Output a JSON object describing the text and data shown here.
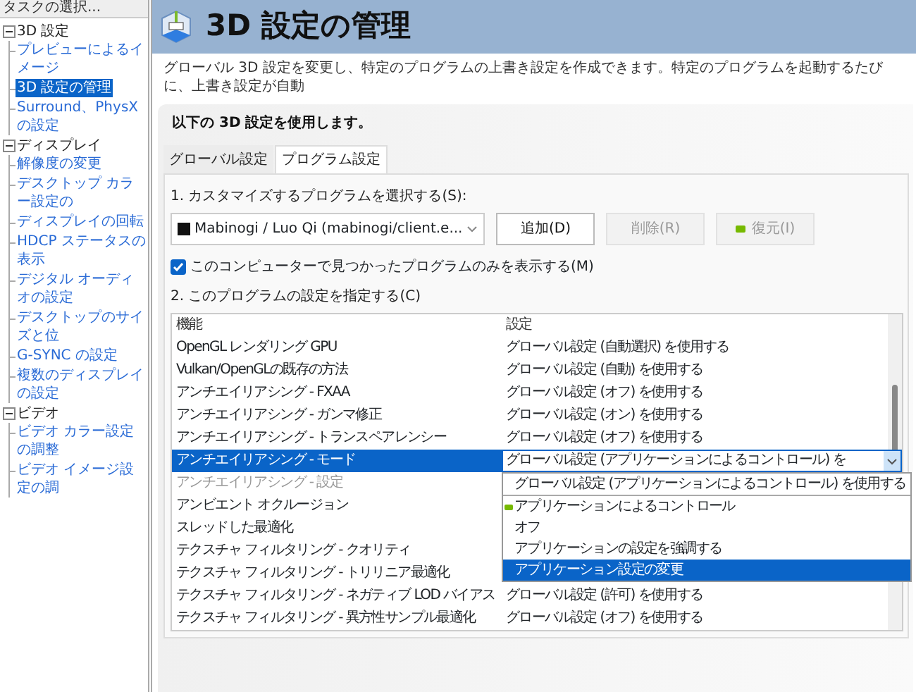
{
  "sidebar": {
    "header": "タスクの選択...",
    "tree": [
      {
        "label": "3D 設定",
        "expanded": true,
        "children": [
          {
            "label": "プレビューによるイメージ",
            "selected": false
          },
          {
            "label": "3D 設定の管理",
            "selected": true
          },
          {
            "label": "Surround、PhysX の設定",
            "selected": false
          }
        ]
      },
      {
        "label": "ディスプレイ",
        "expanded": true,
        "children": [
          {
            "label": "解像度の変更",
            "selected": false
          },
          {
            "label": "デスクトップ カラー設定の",
            "selected": false
          },
          {
            "label": "ディスプレイの回転",
            "selected": false
          },
          {
            "label": "HDCP ステータスの表示",
            "selected": false
          },
          {
            "label": "デジタル オーディオの設定",
            "selected": false
          },
          {
            "label": "デスクトップのサイズと位",
            "selected": false
          },
          {
            "label": "G-SYNC の設定",
            "selected": false
          },
          {
            "label": "複数のディスプレイの設定",
            "selected": false
          }
        ]
      },
      {
        "label": "ビデオ",
        "expanded": true,
        "children": [
          {
            "label": "ビデオ カラー設定の調整",
            "selected": false
          },
          {
            "label": "ビデオ イメージ設定の調",
            "selected": false
          }
        ]
      }
    ]
  },
  "header": {
    "title": "3D 設定の管理"
  },
  "description": "グローバル 3D 設定を変更し、特定のプログラムの上書き設定を作成できます。特定のプログラムを起動するたびに、上書き設定が自動",
  "panel": {
    "heading": "以下の 3D 設定を使用します。",
    "tabs": [
      {
        "label": "グローバル設定",
        "selected": false
      },
      {
        "label": "プログラム設定",
        "selected": true
      }
    ],
    "step1": "1. カスタマイズするプログラムを選択する(S):",
    "program": "Mabinogi / Luo Qi (mabinogi/client.e...",
    "buttons": [
      {
        "label": "追加(D)",
        "disabled": false,
        "kind": "plain"
      },
      {
        "label": "削除(R)",
        "disabled": true,
        "kind": "plain"
      },
      {
        "label": "復元(I)",
        "disabled": true,
        "kind": "restore"
      }
    ],
    "filter": {
      "label": "このコンピューターで見つかったプログラムのみを表示する(M)",
      "checked": true
    },
    "step2": "2. このプログラムの設定を指定する(C)",
    "table": {
      "columns": [
        "機能",
        "設定"
      ],
      "rows": [
        {
          "feature": "OpenGL レンダリング GPU",
          "setting": "グローバル設定 (自動選択) を使用する",
          "selected": false,
          "disabled": false
        },
        {
          "feature": "Vulkan/OpenGLの既存の方法",
          "setting": "グローバル設定 (自動) を使用する",
          "selected": false,
          "disabled": false
        },
        {
          "feature": "アンチエイリアシング - FXAA",
          "setting": "グローバル設定 (オフ) を使用する",
          "selected": false,
          "disabled": false
        },
        {
          "feature": "アンチエイリアシング - ガンマ修正",
          "setting": "グローバル設定 (オン) を使用する",
          "selected": false,
          "disabled": false
        },
        {
          "feature": "アンチエイリアシング - トランスペアレンシー",
          "setting": "グローバル設定 (オフ) を使用する",
          "selected": false,
          "disabled": false
        },
        {
          "feature": "アンチエイリアシング - モード",
          "setting": "グローバル設定 (アプリケーションによるコントロール) を",
          "selected": true,
          "disabled": false,
          "dropdown": {
            "options": [
              {
                "label": "グローバル設定 (アプリケーションによるコントロール) を使用する",
                "selected": false,
                "recommended": false
              },
              {
                "label": "アプリケーションによるコントロール",
                "selected": false,
                "recommended": true
              },
              {
                "label": "オフ",
                "selected": false,
                "recommended": false
              },
              {
                "label": "アプリケーションの設定を強調する",
                "selected": false,
                "recommended": false
              },
              {
                "label": "アプリケーション設定の変更",
                "selected": true,
                "recommended": false
              }
            ]
          }
        },
        {
          "feature": "アンチエイリアシング - 設定",
          "selected": false,
          "disabled": true
        },
        {
          "feature": "アンビエント オクルージョン",
          "selected": false,
          "disabled": false
        },
        {
          "feature": "スレッドした最適化",
          "selected": false,
          "disabled": false
        },
        {
          "feature": "テクスチャ フィルタリング - クオリティ",
          "selected": false,
          "disabled": false
        },
        {
          "feature": "テクスチャ フィルタリング - トリリニア最適化",
          "selected": false,
          "disabled": false
        },
        {
          "feature": "テクスチャ フィルタリング - ネガティブ LOD バイアス",
          "setting": "グローバル設定 (許可) を使用する",
          "selected": false,
          "disabled": false
        },
        {
          "feature": "テクスチャ フィルタリング - 異方性サンプル最適化",
          "setting": "グローバル設定 (オフ) を使用する",
          "selected": false,
          "disabled": false
        }
      ]
    }
  }
}
